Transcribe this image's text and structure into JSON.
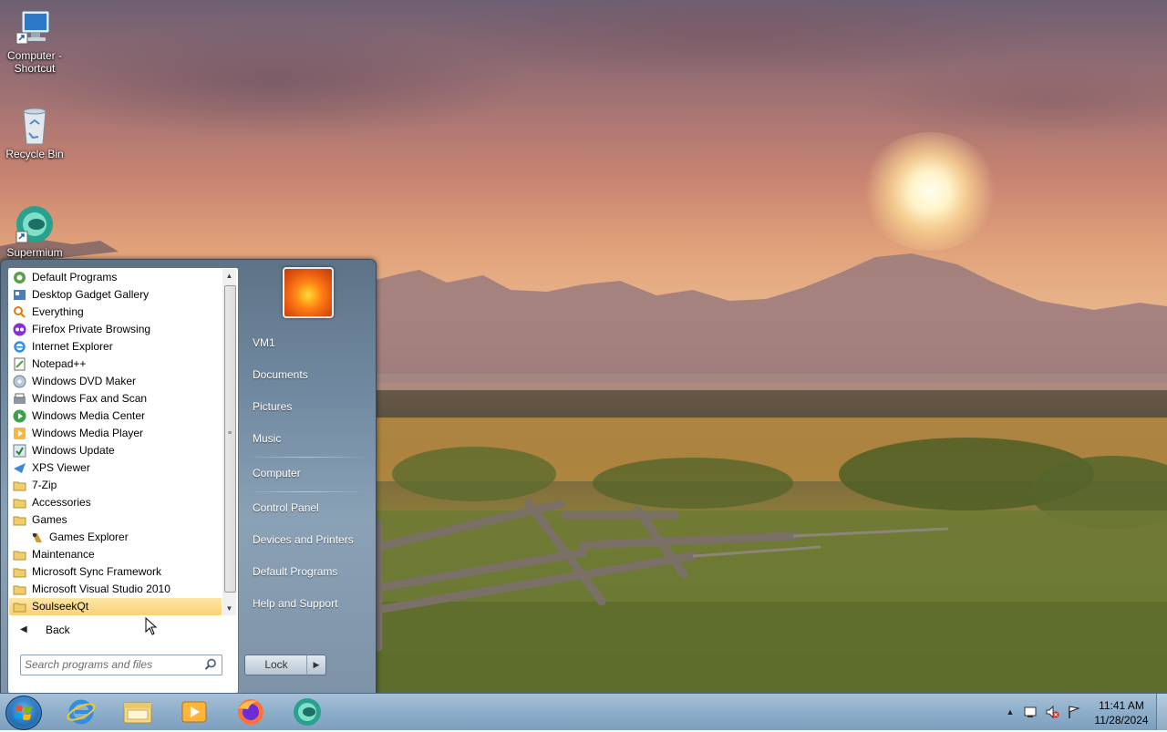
{
  "desktop": {
    "icons": [
      {
        "label": "Computer - Shortcut",
        "icon": "computer-icon"
      },
      {
        "label": "Recycle Bin",
        "icon": "recycle-bin-icon"
      },
      {
        "label": "Supermium",
        "icon": "supermium-icon"
      }
    ]
  },
  "start_menu": {
    "programs": [
      {
        "label": "Default Programs",
        "icon": "default-programs-icon"
      },
      {
        "label": "Desktop Gadget Gallery",
        "icon": "gadget-gallery-icon"
      },
      {
        "label": "Everything",
        "icon": "everything-icon"
      },
      {
        "label": "Firefox Private Browsing",
        "icon": "firefox-private-icon"
      },
      {
        "label": "Internet Explorer",
        "icon": "internet-explorer-icon"
      },
      {
        "label": "Notepad++",
        "icon": "notepad-plus-plus-icon"
      },
      {
        "label": "Windows DVD Maker",
        "icon": "dvd-maker-icon"
      },
      {
        "label": "Windows Fax and Scan",
        "icon": "fax-scan-icon"
      },
      {
        "label": "Windows Media Center",
        "icon": "media-center-icon"
      },
      {
        "label": "Windows Media Player",
        "icon": "media-player-icon"
      },
      {
        "label": "Windows Update",
        "icon": "windows-update-icon"
      },
      {
        "label": "XPS Viewer",
        "icon": "xps-viewer-icon"
      },
      {
        "label": "7-Zip",
        "icon": "folder-icon"
      },
      {
        "label": "Accessories",
        "icon": "folder-icon"
      },
      {
        "label": "Games",
        "icon": "folder-icon"
      },
      {
        "label": "Games Explorer",
        "icon": "games-explorer-icon"
      },
      {
        "label": "Maintenance",
        "icon": "folder-icon"
      },
      {
        "label": "Microsoft Sync Framework",
        "icon": "folder-icon"
      },
      {
        "label": "Microsoft Visual Studio 2010",
        "icon": "folder-icon"
      },
      {
        "label": "SoulseekQt",
        "icon": "folder-icon"
      }
    ],
    "selected_program": "SoulseekQt",
    "back_label": "Back",
    "search_placeholder": "Search programs and files",
    "right_items": {
      "user": "VM1",
      "documents": "Documents",
      "pictures": "Pictures",
      "music": "Music",
      "computer": "Computer",
      "control_panel": "Control Panel",
      "devices_printers": "Devices and Printers",
      "default_programs": "Default Programs",
      "help_support": "Help and Support"
    },
    "lock_label": "Lock"
  },
  "taskbar": {
    "pinned": [
      "internet-explorer-icon",
      "file-explorer-icon",
      "media-player-icon",
      "firefox-icon",
      "supermium-icon"
    ],
    "clock": {
      "time": "11:41 AM",
      "date": "11/28/2024"
    }
  },
  "colors": {
    "selected_highlight": "#f8d178",
    "taskbar": "#8fb0cc",
    "start_menu_right": "#7189a0"
  }
}
